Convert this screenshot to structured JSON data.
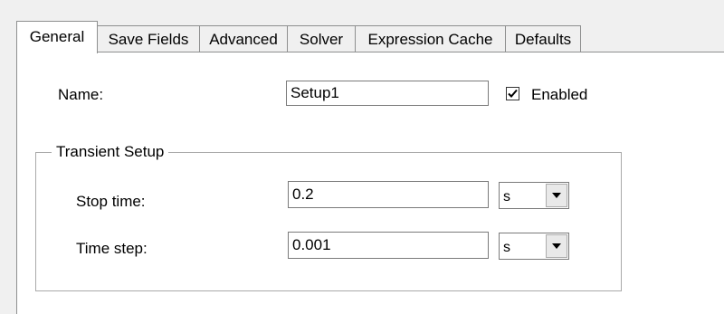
{
  "tabs": [
    {
      "label": "General",
      "active": true
    },
    {
      "label": "Save Fields",
      "active": false
    },
    {
      "label": "Advanced",
      "active": false
    },
    {
      "label": "Solver",
      "active": false
    },
    {
      "label": "Expression Cache",
      "active": false
    },
    {
      "label": "Defaults",
      "active": false
    }
  ],
  "general": {
    "name_label": "Name:",
    "name_value": "Setup1",
    "enabled_label": "Enabled",
    "enabled_checked": true
  },
  "transient": {
    "group_title": "Transient Setup",
    "stop_time_label": "Stop time:",
    "stop_time_value": "0.2",
    "stop_time_unit": "s",
    "time_step_label": "Time step:",
    "time_step_value": "0.001",
    "time_step_unit": "s"
  },
  "icons": {
    "checkmark": "checkmark-icon",
    "dropdown": "dropdown-arrow-icon"
  }
}
